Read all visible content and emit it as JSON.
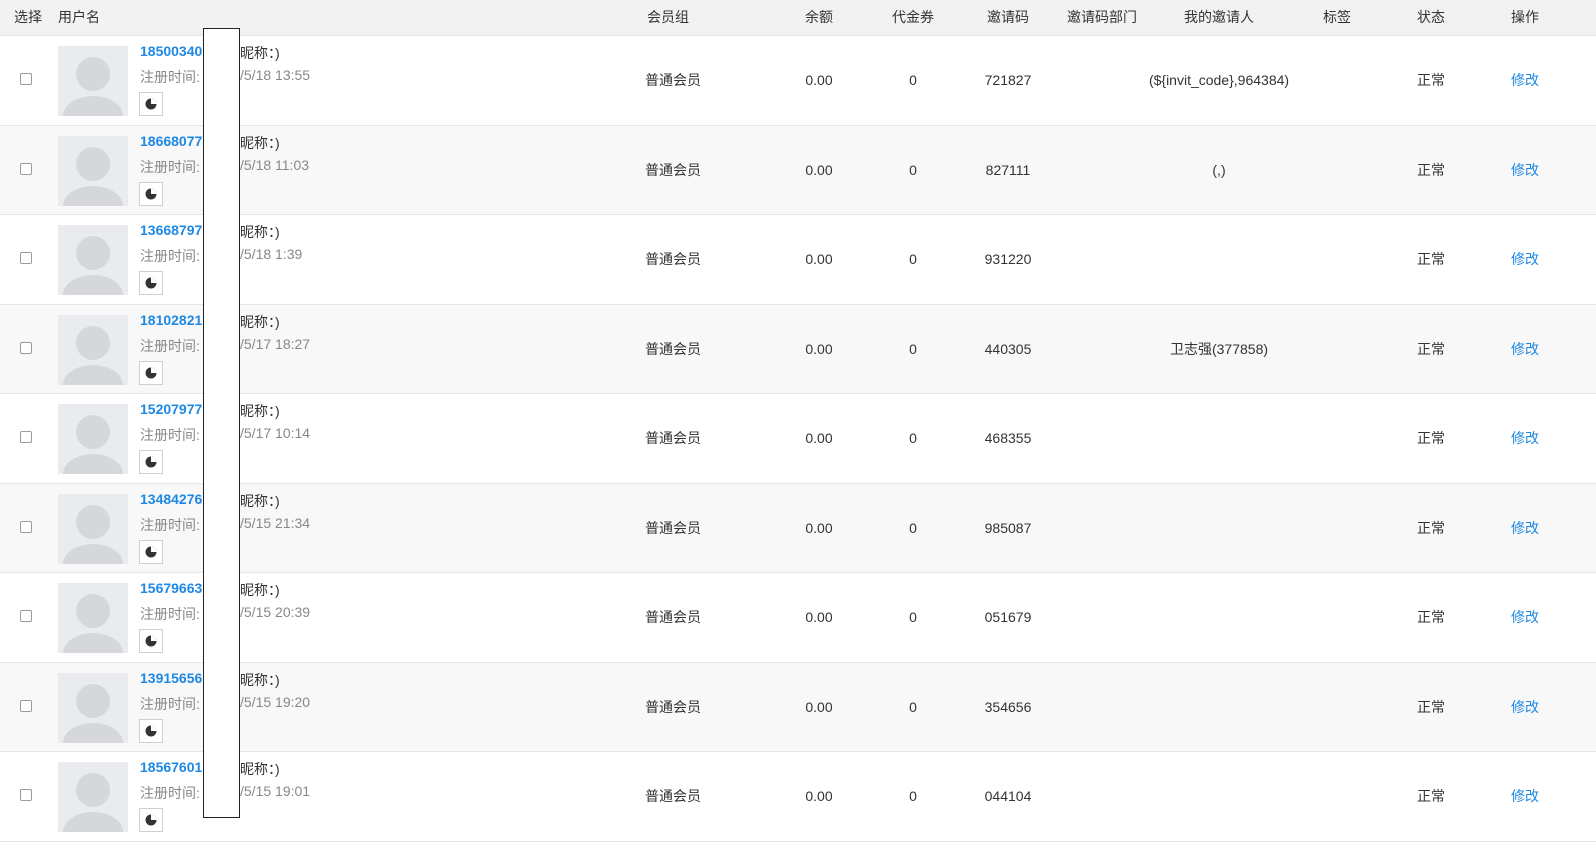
{
  "columns": {
    "select": "选择",
    "username": "用户名",
    "member_group": "会员组",
    "balance": "余额",
    "voucher": "代金券",
    "invite_code": "邀请码",
    "invite_dept": "邀请码部门",
    "my_inviter": "我的邀请人",
    "tag": "标签",
    "status": "状态",
    "action": "操作"
  },
  "labels": {
    "reg_time": "注册时间:",
    "edit": "修改"
  },
  "rows": [
    {
      "username": "18500340",
      "nickname": "昵称：)",
      "reg_time": "/5/18 13:55",
      "group": "普通会员",
      "balance": "0.00",
      "voucher": "0",
      "invite_code": "721827",
      "invite_dept": "",
      "inviter": "(${invit_code},964384)",
      "tag": "",
      "status": "正常"
    },
    {
      "username": "18668077",
      "nickname": "昵称：)",
      "reg_time": "/5/18 11:03",
      "group": "普通会员",
      "balance": "0.00",
      "voucher": "0",
      "invite_code": "827111",
      "invite_dept": "",
      "inviter": "(,)",
      "tag": "",
      "status": "正常"
    },
    {
      "username": "13668797",
      "nickname": "昵称：)",
      "reg_time": "/5/18 1:39",
      "group": "普通会员",
      "balance": "0.00",
      "voucher": "0",
      "invite_code": "931220",
      "invite_dept": "",
      "inviter": "",
      "tag": "",
      "status": "正常"
    },
    {
      "username": "18102821",
      "nickname": "昵称：)",
      "reg_time": "/5/17 18:27",
      "group": "普通会员",
      "balance": "0.00",
      "voucher": "0",
      "invite_code": "440305",
      "invite_dept": "",
      "inviter": "卫志强(377858)",
      "tag": "",
      "status": "正常"
    },
    {
      "username": "15207977",
      "nickname": "昵称：)",
      "reg_time": "/5/17 10:14",
      "group": "普通会员",
      "balance": "0.00",
      "voucher": "0",
      "invite_code": "468355",
      "invite_dept": "",
      "inviter": "",
      "tag": "",
      "status": "正常"
    },
    {
      "username": "13484276",
      "nickname": "昵称：)",
      "reg_time": "/5/15 21:34",
      "group": "普通会员",
      "balance": "0.00",
      "voucher": "0",
      "invite_code": "985087",
      "invite_dept": "",
      "inviter": "",
      "tag": "",
      "status": "正常"
    },
    {
      "username": "15679663",
      "nickname": "昵称：)",
      "reg_time": "/5/15 20:39",
      "group": "普通会员",
      "balance": "0.00",
      "voucher": "0",
      "invite_code": "051679",
      "invite_dept": "",
      "inviter": "",
      "tag": "",
      "status": "正常"
    },
    {
      "username": "13915656",
      "nickname": "昵称：)",
      "reg_time": "/5/15 19:20",
      "group": "普通会员",
      "balance": "0.00",
      "voucher": "0",
      "invite_code": "354656",
      "invite_dept": "",
      "inviter": "",
      "tag": "",
      "status": "正常"
    },
    {
      "username": "18567601",
      "nickname": "昵称：)",
      "reg_time": "/5/15 19:01",
      "group": "普通会员",
      "balance": "0.00",
      "voucher": "0",
      "invite_code": "044104",
      "invite_dept": "",
      "inviter": "",
      "tag": "",
      "status": "正常"
    }
  ],
  "colors": {
    "link": "#1e88e5",
    "header_bg": "#f2f2f2",
    "alt_row_bg": "#f8f8f8"
  },
  "icons": {
    "avatar": "user-placeholder-icon",
    "history": "pie-chart-icon"
  }
}
